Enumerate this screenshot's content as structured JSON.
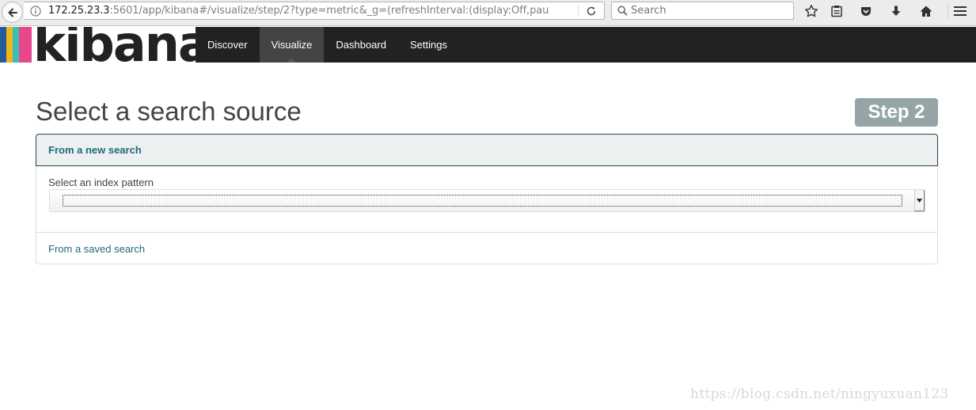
{
  "browser": {
    "url_host": "172.25.23.3",
    "url_rest": ":5601/app/kibana#/visualize/step/2?type=metric&_g=(refreshInterval:(display:Off,pau",
    "search_placeholder": "Search"
  },
  "kibana": {
    "logo_text": "kibana",
    "logo_colors": [
      "#e8488b",
      "#3cbeb6",
      "#f0b71a",
      "#245c9a"
    ],
    "nav": [
      {
        "label": "Discover"
      },
      {
        "label": "Visualize"
      },
      {
        "label": "Dashboard"
      },
      {
        "label": "Settings"
      }
    ],
    "active_tab": "Visualize"
  },
  "page": {
    "title": "Select a search source",
    "step_badge": "Step 2",
    "panel": {
      "heading": "From a new search",
      "index_label": "Select an index pattern",
      "index_value": "",
      "saved_search_link": "From a saved search"
    }
  },
  "watermark": "https://blog.csdn.net/ningyuxuan123"
}
